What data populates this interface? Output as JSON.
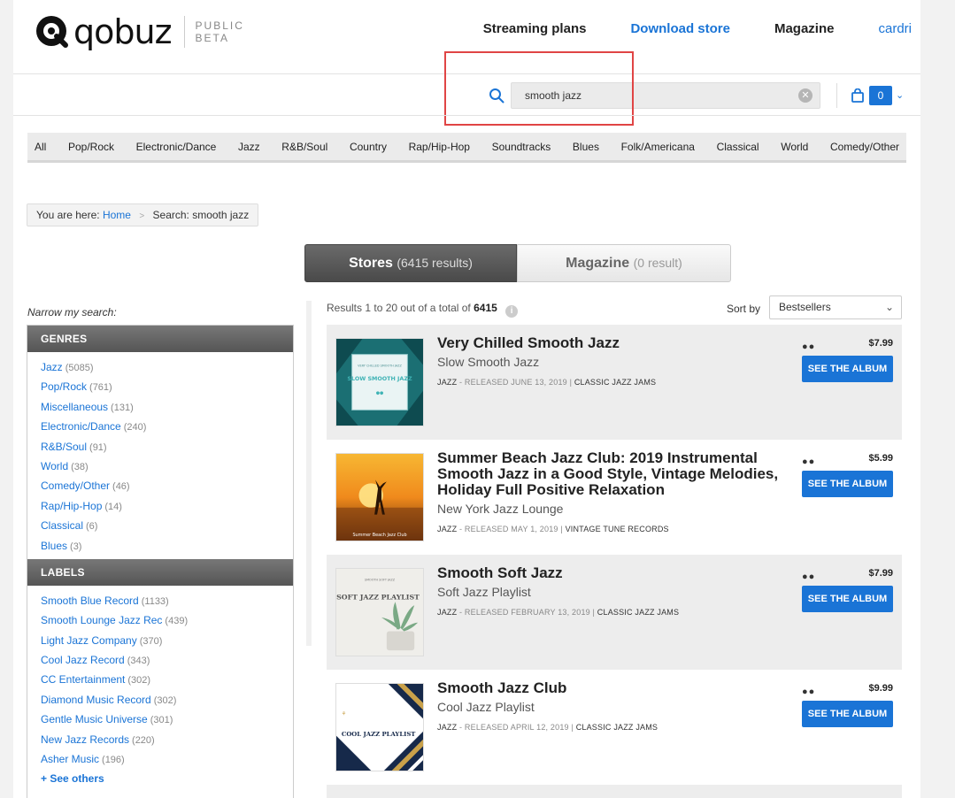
{
  "header": {
    "logo_text": "qobuz",
    "beta_line1": "PUBLIC",
    "beta_line2": "BETA",
    "nav": [
      "Streaming plans",
      "Download store",
      "Magazine"
    ],
    "user": "cardri"
  },
  "search": {
    "value": "smooth jazz"
  },
  "cart": {
    "count": "0"
  },
  "genres_nav": [
    "All",
    "Pop/Rock",
    "Electronic/Dance",
    "Jazz",
    "R&B/Soul",
    "Country",
    "Rap/Hip-Hop",
    "Soundtracks",
    "Blues",
    "Folk/Americana",
    "Classical",
    "World",
    "Comedy/Other"
  ],
  "breadcrumb": {
    "prefix": "You are here:",
    "home": "Home",
    "sep": ">",
    "current": "Search: smooth jazz"
  },
  "tabs": {
    "stores_label": "Stores",
    "stores_count": "(6415 results)",
    "magazine_label": "Magazine",
    "magazine_count": "(0 result)"
  },
  "sidebar": {
    "narrow_label": "Narrow my search:",
    "genres_title": "GENRES",
    "genres": [
      {
        "name": "Jazz",
        "count": "(5085)"
      },
      {
        "name": "Pop/Rock",
        "count": "(761)"
      },
      {
        "name": "Miscellaneous",
        "count": "(131)"
      },
      {
        "name": "Electronic/Dance",
        "count": "(240)"
      },
      {
        "name": "R&B/Soul",
        "count": "(91)"
      },
      {
        "name": "World",
        "count": "(38)"
      },
      {
        "name": "Comedy/Other",
        "count": "(46)"
      },
      {
        "name": "Rap/Hip-Hop",
        "count": "(14)"
      },
      {
        "name": "Classical",
        "count": "(6)"
      },
      {
        "name": "Blues",
        "count": "(3)"
      }
    ],
    "labels_title": "LABELS",
    "labels": [
      {
        "name": "Smooth Blue Record",
        "count": "(1133)"
      },
      {
        "name": "Smooth Lounge Jazz Rec",
        "count": "(439)"
      },
      {
        "name": "Light Jazz Company",
        "count": "(370)"
      },
      {
        "name": "Cool Jazz Record",
        "count": "(343)"
      },
      {
        "name": "CC Entertainment",
        "count": "(302)"
      },
      {
        "name": "Diamond Music Record",
        "count": "(302)"
      },
      {
        "name": "Gentle Music Universe",
        "count": "(301)"
      },
      {
        "name": "New Jazz Records",
        "count": "(220)"
      },
      {
        "name": "Asher Music",
        "count": "(196)"
      }
    ],
    "see_others": "+ See others"
  },
  "results": {
    "summary_prefix": "Results 1 to 20 out of a total of",
    "total": "6415",
    "sort_label": "Sort by",
    "sort_value": "Bestsellers",
    "buy_label": "SEE THE ALBUM",
    "quality_marker": "●●",
    "albums": [
      {
        "title": "Very Chilled Smooth Jazz",
        "artist": "Slow Smooth Jazz",
        "genre": "JAZZ",
        "released": "- RELEASED JUNE 13, 2019 |",
        "label": "CLASSIC JAZZ JAMS",
        "price": "$7.99",
        "cover_text": "SLOW SMOOTH JAZZ",
        "cover_small": "VERY CHILLED SMOOTH JAZZ"
      },
      {
        "title": "Summer Beach Jazz Club: 2019 Instrumental Smooth Jazz in a Good Style, Vintage Melodies, Holiday Full Positive Relaxation",
        "artist": "New York Jazz Lounge",
        "genre": "JAZZ",
        "released": "- RELEASED MAY 1, 2019 |",
        "label": "VINTAGE TUNE RECORDS",
        "price": "$5.99",
        "cover_text": "Summer Beach Jazz Club"
      },
      {
        "title": "Smooth Soft Jazz",
        "artist": "Soft Jazz Playlist",
        "genre": "JAZZ",
        "released": "- RELEASED FEBRUARY 13, 2019 |",
        "label": "CLASSIC JAZZ JAMS",
        "price": "$7.99",
        "cover_text": "SOFT JAZZ PLAYLIST",
        "cover_small": "SMOOTH SOFT JAZZ"
      },
      {
        "title": "Smooth Jazz Club",
        "artist": "Cool Jazz Playlist",
        "genre": "JAZZ",
        "released": "- RELEASED APRIL 12, 2019 |",
        "label": "CLASSIC JAZZ JAMS",
        "price": "$9.99",
        "cover_text": "COOL JAZZ PLAYLIST"
      }
    ]
  },
  "colors": {
    "accent": "#1a74d6",
    "highlight": "#e04545"
  }
}
